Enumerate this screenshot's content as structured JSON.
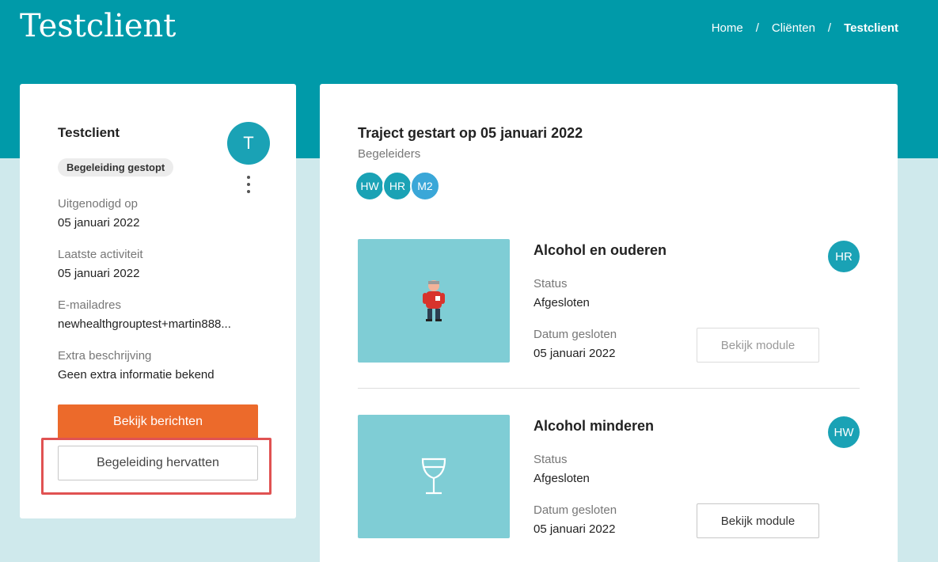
{
  "header": {
    "title": "Testclient",
    "breadcrumb": [
      "Home",
      "Cliënten",
      "Testclient"
    ],
    "separator": "/"
  },
  "client": {
    "name": "Testclient",
    "avatar_initial": "T",
    "status": "Begeleiding gestopt",
    "fields": [
      {
        "label": "Uitgenodigd op",
        "value": "05 januari 2022"
      },
      {
        "label": "Laatste activiteit",
        "value": "05 januari 2022"
      },
      {
        "label": "E-mailadres",
        "value": "newhealthgrouptest+martin888..."
      },
      {
        "label": "Extra beschrijving",
        "value": "Geen extra informatie bekend"
      }
    ],
    "view_messages_label": "Bekijk berichten",
    "resume_label": "Begeleiding hervatten"
  },
  "traject": {
    "title": "Traject gestart op 05 januari 2022",
    "supervisors_label": "Begeleiders",
    "supervisors": [
      {
        "initials": "HW",
        "color": "#1aa2b5"
      },
      {
        "initials": "HR",
        "color": "#1aa2b5"
      },
      {
        "initials": "M2",
        "color": "#3aa7d8"
      }
    ]
  },
  "modules": [
    {
      "title": "Alcohol en ouderen",
      "avatar": "HR",
      "status_label": "Status",
      "status": "Afgesloten",
      "date_label": "Datum gesloten",
      "date": "05 januari 2022",
      "button_label": "Bekijk module",
      "icon": "elderly-person-icon"
    },
    {
      "title": "Alcohol minderen",
      "avatar": "HW",
      "status_label": "Status",
      "status": "Afgesloten",
      "date_label": "Datum gesloten",
      "date": "05 januari 2022",
      "button_label": "Bekijk module",
      "icon": "wine-glass-icon"
    }
  ],
  "colors": {
    "brand": "#009aa9",
    "accent": "#ec6a2b",
    "highlight": "#e05252",
    "background": "#cfe9ec",
    "module_image": "#7fcdd5"
  }
}
